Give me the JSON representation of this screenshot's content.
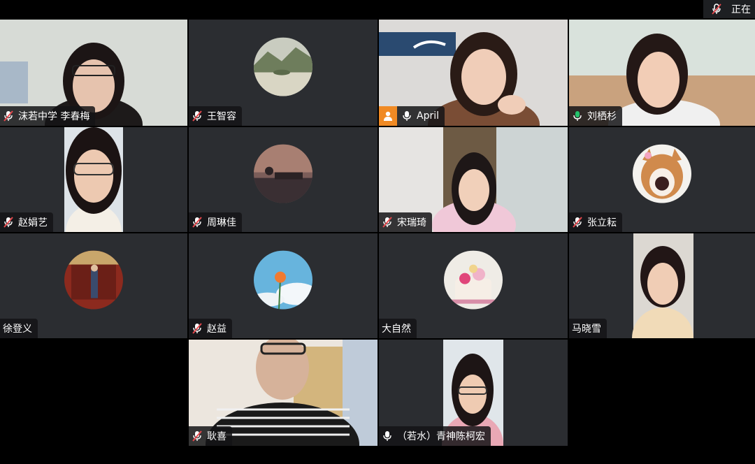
{
  "recording": {
    "label": "正在"
  },
  "participants": [
    {
      "name": "沫若中学 李春梅",
      "muted": true
    },
    {
      "name": "王智容",
      "muted": true
    },
    {
      "name": "April",
      "muted": false,
      "host": true
    },
    {
      "name": "刘栖杉",
      "muted": false,
      "speaking": true
    },
    {
      "name": "赵娟艺",
      "muted": true
    },
    {
      "name": "周琳佳",
      "muted": true
    },
    {
      "name": "宋瑞琦",
      "muted": true
    },
    {
      "name": "张立耘",
      "muted": true
    },
    {
      "name": "徐登义",
      "muted": false,
      "no_mic_icon": true
    },
    {
      "name": "赵益",
      "muted": true
    },
    {
      "name": "大自然",
      "muted": false,
      "no_mic_icon": true
    },
    {
      "name": "马晓雪",
      "muted": false,
      "no_mic_icon": true
    },
    {
      "name": "耿喜",
      "muted": true
    },
    {
      "name": "（若水）青神陈柯宏",
      "muted": false
    }
  ],
  "colors": {
    "tile_bg": "#2b2d31",
    "active_border": "#23c26b",
    "muted_red": "#e5484d",
    "host_orange": "#f08a24"
  }
}
